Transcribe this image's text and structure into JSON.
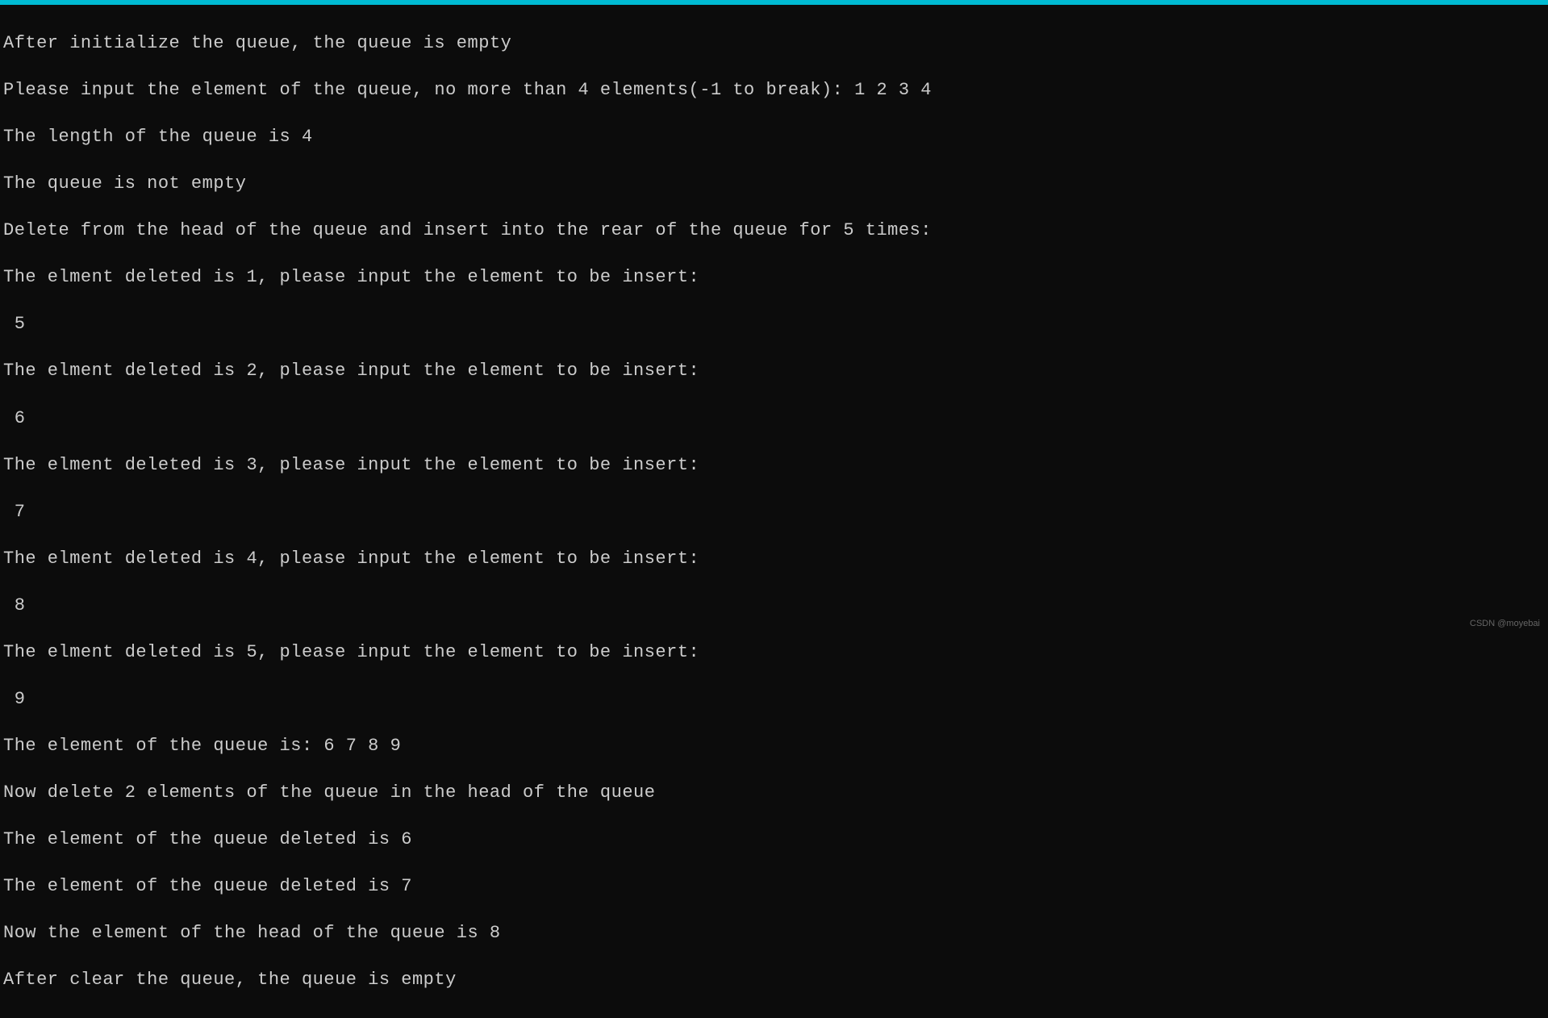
{
  "titleBar": {
    "color": "#00bcd4"
  },
  "terminal": {
    "lines": [
      "After initialize the queue, the queue is empty",
      "Please input the element of the queue, no more than 4 elements(-1 to break): 1 2 3 4",
      "The length of the queue is 4",
      "The queue is not empty",
      "Delete from the head of the queue and insert into the rear of the queue for 5 times:",
      "The elment deleted is 1, please input the element to be insert:",
      " 5",
      "The elment deleted is 2, please input the element to be insert:",
      " 6",
      "The elment deleted is 3, please input the element to be insert:",
      " 7",
      "The elment deleted is 4, please input the element to be insert:",
      " 8",
      "The elment deleted is 5, please input the element to be insert:",
      " 9",
      "The element of the queue is: 6 7 8 9",
      "Now delete 2 elements of the queue in the head of the queue",
      "The element of the queue deleted is 6",
      "The element of the queue deleted is 7",
      "Now the element of the head of the queue is 8",
      "After clear the queue, the queue is empty"
    ]
  },
  "watermark": {
    "text": "CSDN @moyebai"
  }
}
